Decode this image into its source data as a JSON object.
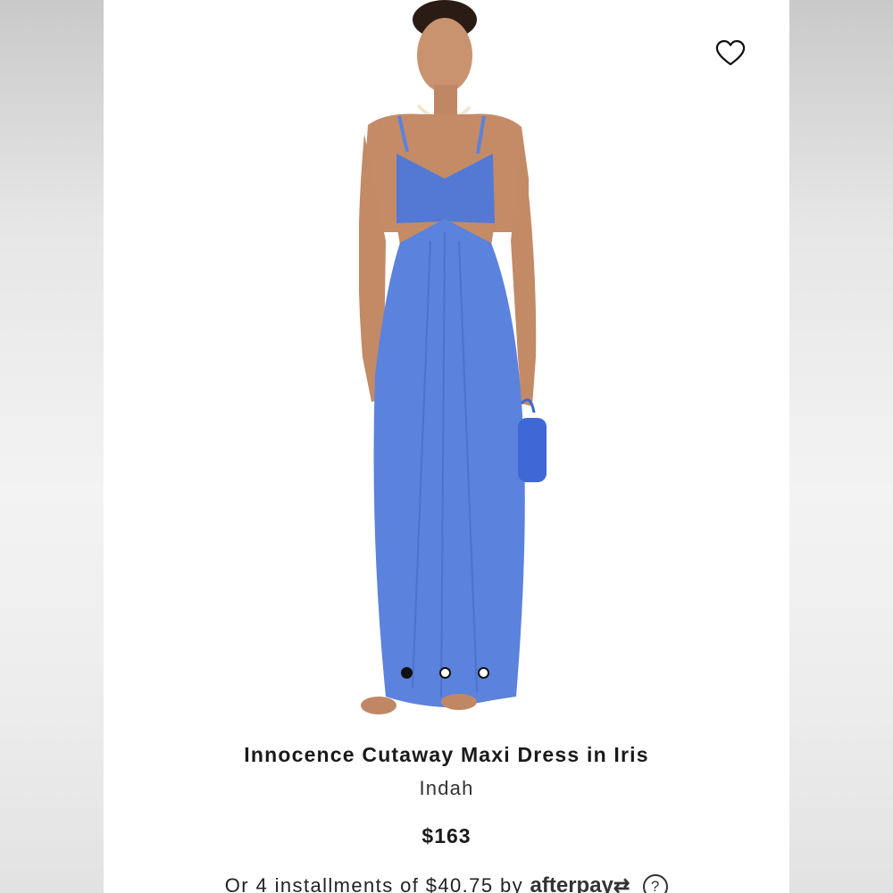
{
  "product": {
    "title": "Innocence Cutaway Maxi Dress in Iris",
    "brand": "Indah",
    "price": "$163",
    "dress_color": "#5b82dc"
  },
  "payment": {
    "installments_text": "Or 4 installments of $40.75 by",
    "provider": "afterpay",
    "help_icon_glyph": "?"
  },
  "carousel": {
    "total_images": 3,
    "active_index": 0
  },
  "icons": {
    "favorite": "heart-icon",
    "help": "question-circle-icon"
  }
}
